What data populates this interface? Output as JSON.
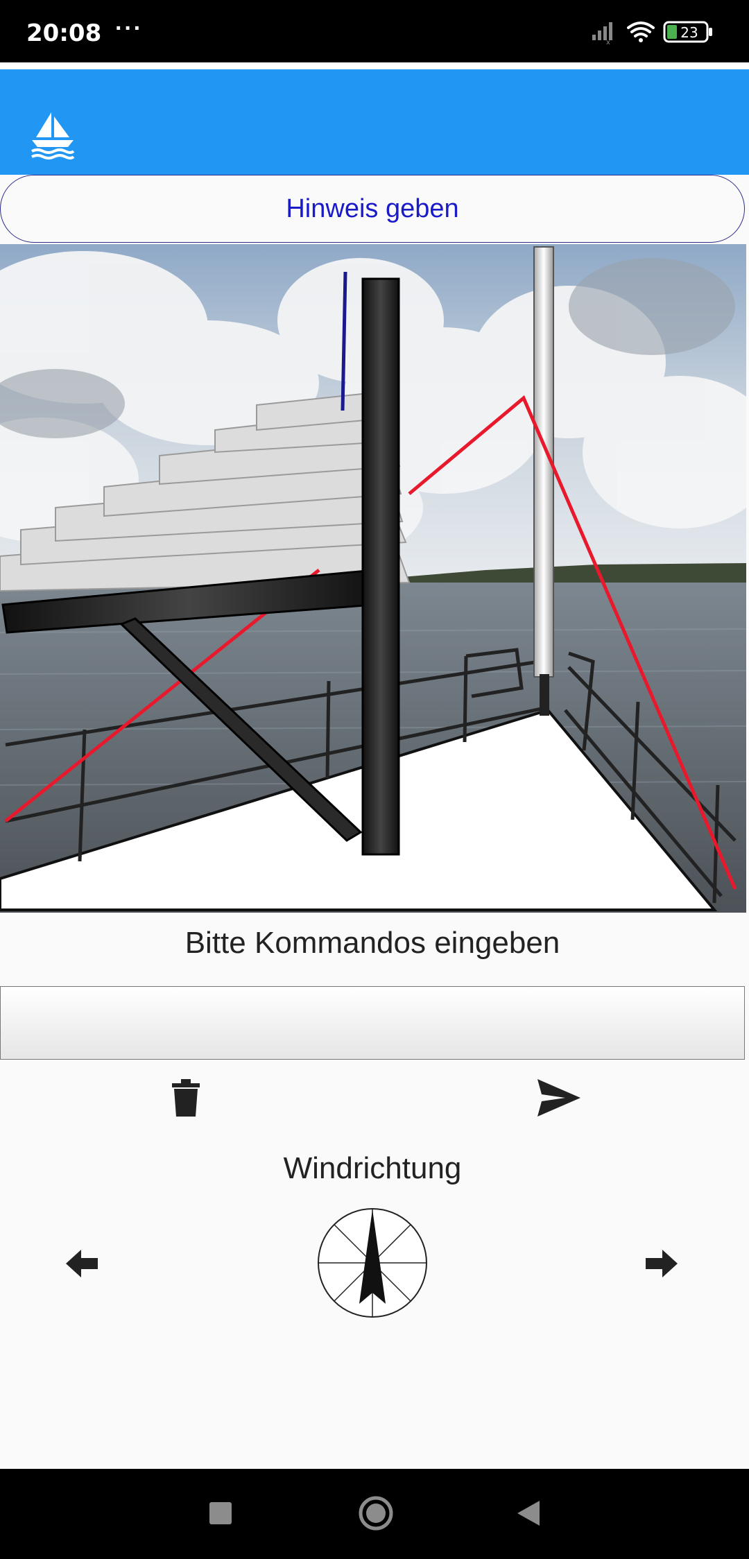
{
  "status_bar": {
    "time": "20:08",
    "more": "···",
    "battery": "23",
    "signal_icon": "signal-icon",
    "wifi_icon": "wifi-icon",
    "battery_icon": "battery-icon"
  },
  "app_bar": {
    "logo_icon": "sailboat-icon",
    "color": "#2196f3"
  },
  "hint_button": {
    "label": "Hinweis geben"
  },
  "scene": {
    "description_icon": "sailboat-deck-scene"
  },
  "command": {
    "label": "Bitte Kommandos eingeben",
    "value": "",
    "placeholder": ""
  },
  "actions": {
    "delete_icon": "trash-icon",
    "send_icon": "send-icon"
  },
  "wind": {
    "label": "Windrichtung",
    "left_icon": "arrow-left-icon",
    "right_icon": "arrow-right-icon",
    "compass_icon": "compass-icon"
  },
  "nav_bar": {
    "recents_icon": "square-icon",
    "home_icon": "circle-icon",
    "back_icon": "triangle-back-icon"
  }
}
